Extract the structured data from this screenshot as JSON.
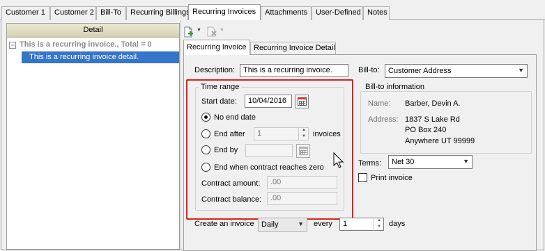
{
  "top_tabs": [
    {
      "label": "Customer 1"
    },
    {
      "label": "Customer 2"
    },
    {
      "label": "Bill-To"
    },
    {
      "label": "Recurring Billings"
    },
    {
      "label": "Recurring Invoices"
    },
    {
      "label": "Attachments"
    },
    {
      "label": "User-Defined"
    },
    {
      "label": "Notes"
    }
  ],
  "left_panel": {
    "header": "Detail",
    "group_label": "This is a recurring invoice., Total = 0",
    "selected_row": "This is a recurring invoice detail."
  },
  "toolbar": {
    "icons": [
      "new-document-icon",
      "dropdown-arrow-icon",
      "delete-icon",
      "dropdown-arrow-icon"
    ]
  },
  "inner_tabs": [
    {
      "label": "Recurring Invoice"
    },
    {
      "label": "Recurring Invoice Detail"
    }
  ],
  "form": {
    "description_label": "Description:",
    "description_value": "This is a recurring invoice.",
    "billto_label": "Bill-to:",
    "billto_value": "Customer Address",
    "time_range": {
      "title": "Time range",
      "start_date_label": "Start date:",
      "start_date_value": "10/04/2016",
      "no_end_date": "No end date",
      "end_after": "End after",
      "end_after_value": "1",
      "invoices_label": "invoices",
      "end_by": "End by",
      "end_by_value": "",
      "end_when_contract": "End when contract reaches zero",
      "contract_amount_label": "Contract amount:",
      "contract_amount_value": ".00",
      "contract_balance_label": "Contract balance:",
      "contract_balance_value": ".00",
      "selected_option": "no_end_date"
    },
    "billto_info": {
      "title": "Bill-to information",
      "name_label": "Name:",
      "name_value": "Barber, Devin A.",
      "address_label": "Address:",
      "address_lines": [
        "1837 S Lake Rd",
        "PO Box 240",
        "Anywhere UT 99999"
      ]
    },
    "terms_label": "Terms:",
    "terms_value": "Net 30",
    "print_invoice_label": "Print invoice",
    "print_invoice_checked": false,
    "create_invoice_label": "Create an invoice",
    "frequency_value": "Daily",
    "every_label": "every",
    "every_value": "1",
    "days_label": "days"
  },
  "colors": {
    "selection": "#3575c9",
    "highlight_border": "#e0201b",
    "header_gradient_top": "#ecead6",
    "header_gradient_bottom": "#d3d0b2"
  }
}
